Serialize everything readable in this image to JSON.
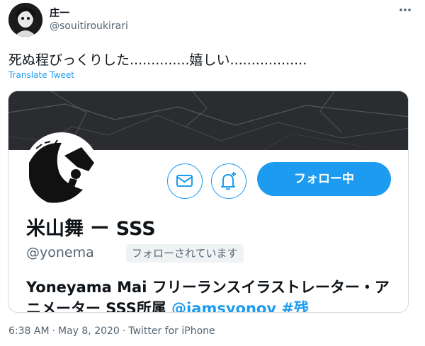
{
  "author": {
    "name": "庄一",
    "handle": "@souitiroukirari"
  },
  "tweet": {
    "text": "死ぬ程びっくりした..............嬉しい..................",
    "translate_label": "Translate Tweet"
  },
  "embedded_profile": {
    "display_name": "米山舞 ー SSS",
    "handle": "@yonema",
    "follows_you_badge": "フォローされています",
    "follow_button_label": "フォロー中",
    "bio_text": "Yoneyama Mai フリーランスイラストレーター・アニメーター SSS所属 ",
    "bio_links": "@jamsyonov #残"
  },
  "timestamp": {
    "time": "6:38 AM",
    "date": "May 8, 2020",
    "source": "Twitter for iPhone"
  },
  "colors": {
    "accent": "#1d9bf0",
    "text_secondary": "#536471",
    "banner": "#2b2c30"
  },
  "icons": [
    "more-icon",
    "mail-icon",
    "bell-plus-icon"
  ]
}
